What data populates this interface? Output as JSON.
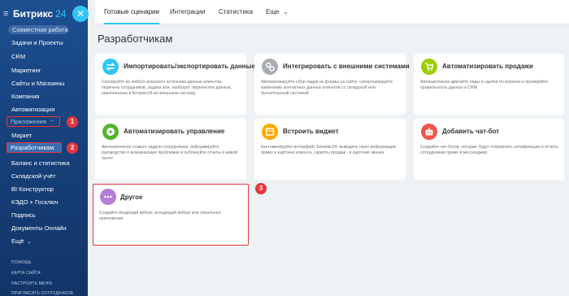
{
  "app": {
    "logo": "Битрикс",
    "logo_num": "24",
    "close": "✕"
  },
  "sidebar": {
    "group_label": "Совместная работа",
    "items": [
      {
        "label": "Задачи и Проекты"
      },
      {
        "label": "CRM"
      },
      {
        "label": "Маркетинг"
      },
      {
        "label": "Сайты и Магазины"
      },
      {
        "label": "Компания"
      },
      {
        "label": "Автоматизация"
      },
      {
        "label": "Приложения"
      },
      {
        "label": "Маркет"
      },
      {
        "label": "Разработчикам"
      },
      {
        "label": "Баланс и статистика"
      },
      {
        "label": "Складской учёт"
      },
      {
        "label": "BI Конструктор"
      },
      {
        "label": "КЭДО + Госключ"
      },
      {
        "label": "Подпись"
      },
      {
        "label": "Документы Онлайн"
      },
      {
        "label": "Ещё"
      }
    ],
    "footer": [
      "ПОМОЩЬ",
      "КАРТА САЙТА",
      "НАСТРОИТЬ МЕНЮ",
      "ПРИГЛАСИТЬ СОТРУДНИКОВ"
    ]
  },
  "badges": {
    "b1": "1",
    "b2": "2",
    "b3": "3"
  },
  "tabs": [
    {
      "label": "Готовые сценарии",
      "active": true
    },
    {
      "label": "Интеграции"
    },
    {
      "label": "Статистика"
    },
    {
      "label": "Еще"
    }
  ],
  "page_title": "Разработчикам",
  "cards": [
    {
      "title": "Импортировать/экспортировать данные",
      "desc": "Скопируйте из любого внешнего источника данные клиентов, перечень сотрудников, задачи или, наоборот, перенесите данные, накопленные в Битрикс24 во внешнюю систему",
      "icon": "import-export-icon",
      "color": "#2fc6f6"
    },
    {
      "title": "Интегрировать с внешними системами",
      "desc": "Автоматизируйте сбор лидов из формы на сайте, синхронизируйте изменение контактных данных клиентов со складской или бухгалтерской системой",
      "icon": "integration-icon",
      "color": "#a8adb4"
    },
    {
      "title": "Автоматизировать продажи",
      "desc": "Автоматически двигайте лиды и сделки по воронке и проверяйте правильность данных в CRM",
      "icon": "sales-cart-icon",
      "color": "#9dcf00"
    },
    {
      "title": "Автоматизировать управление",
      "desc": "Автоматически ставьте задачи сотрудникам, информируйте руководство о возникающих проблемах и публикуйте отчеты в живой ленте",
      "icon": "play-icon",
      "color": "#55b52e"
    },
    {
      "title": "Встроить виджет",
      "desc": "Кастомизируйте интерфейс Битрикс24: выводите свою информацию прямо в карточке клиента, скрипты продаж - в карточке звонка",
      "icon": "widget-icon",
      "color": "#ffa900"
    },
    {
      "title": "Добавить чат-бот",
      "desc": "Создайте чат-ботов, которые будут отправлять нотификации и отчеты сотрудникам прямо в мессенджер",
      "icon": "chatbot-icon",
      "color": "#f0544c"
    },
    {
      "title": "Другое",
      "desc": "Создайте входящий вебхук, исходящий вебхук или локальное приложение",
      "icon": "more-dots-icon",
      "color": "#b57ed6"
    }
  ]
}
